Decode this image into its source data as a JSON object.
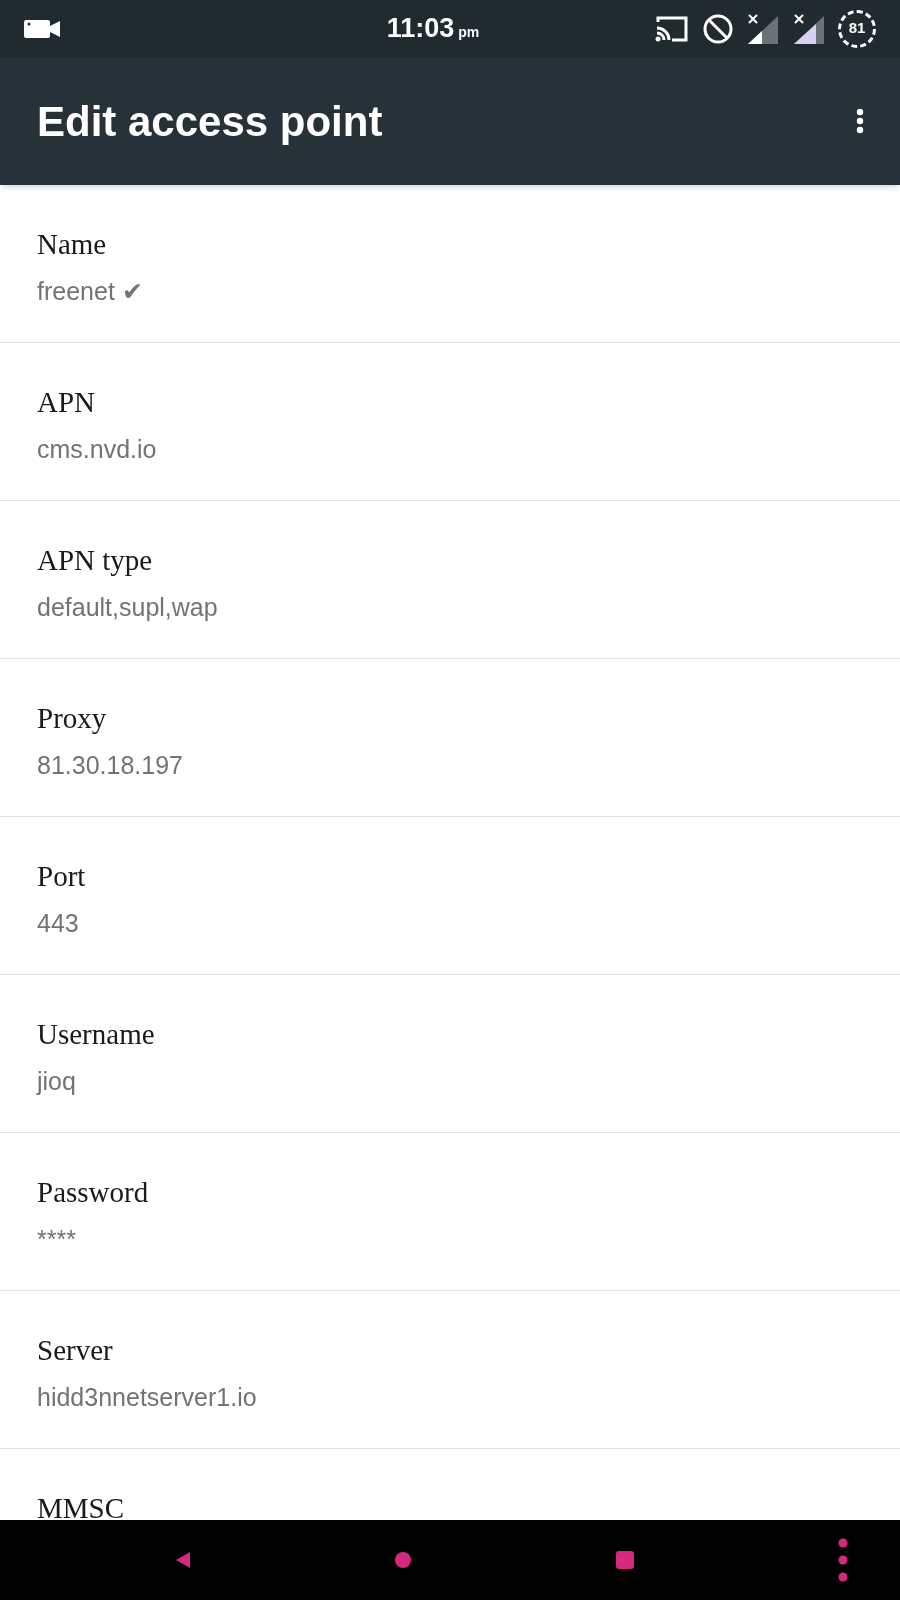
{
  "status_bar": {
    "time": "11:03",
    "ampm": "pm",
    "battery": "81"
  },
  "app_bar": {
    "title": "Edit access point"
  },
  "settings": [
    {
      "title": "Name",
      "value": "freenet ✔"
    },
    {
      "title": "APN",
      "value": "cms.nvd.io"
    },
    {
      "title": "APN type",
      "value": "default,supl,wap"
    },
    {
      "title": "Proxy",
      "value": "81.30.18.197"
    },
    {
      "title": "Port",
      "value": "443"
    },
    {
      "title": "Username",
      "value": "jioq"
    },
    {
      "title": "Password",
      "value": "****"
    },
    {
      "title": "Server",
      "value": "hidd3nnetserver1.io"
    },
    {
      "title": "MMSC"
    }
  ]
}
